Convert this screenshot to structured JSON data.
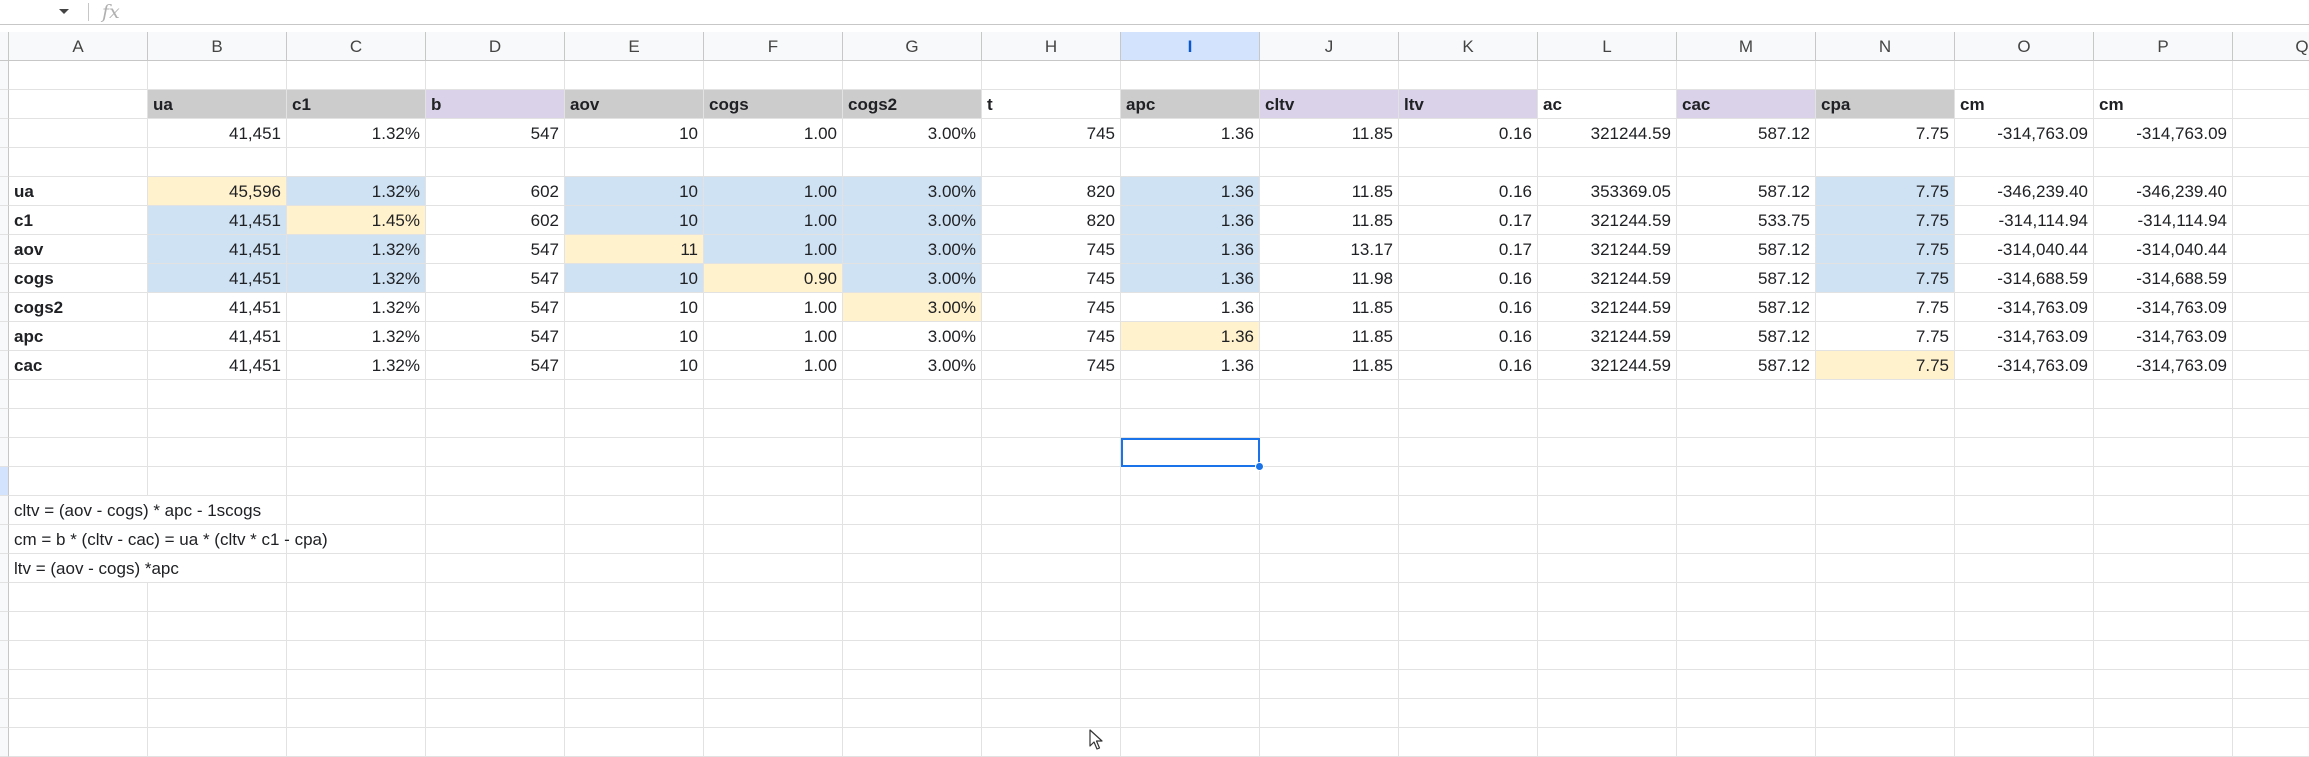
{
  "formula_bar": {
    "fx_label": "fx",
    "formula_value": ""
  },
  "columns": [
    "A",
    "B",
    "C",
    "D",
    "E",
    "F",
    "G",
    "H",
    "I",
    "J",
    "K",
    "L",
    "M",
    "N",
    "O",
    "P",
    "Q"
  ],
  "selected_column": "I",
  "header_row": [
    "",
    "ua",
    "c1",
    "b",
    "aov",
    "cogs",
    "cogs2",
    "t",
    "apc",
    "cltv",
    "ltv",
    "ac",
    "cac",
    "cpa",
    "cm",
    "cm"
  ],
  "base_row": [
    "",
    "41,451",
    "1.32%",
    "547",
    "10",
    "1.00",
    "3.00%",
    "745",
    "1.36",
    "11.85",
    "0.16",
    "321244.59",
    "587.12",
    "7.75",
    "-314,763.09",
    "-314,763.09"
  ],
  "scenario_rows": [
    [
      "ua",
      "45,596",
      "1.32%",
      "602",
      "10",
      "1.00",
      "3.00%",
      "820",
      "1.36",
      "11.85",
      "0.16",
      "353369.05",
      "587.12",
      "7.75",
      "-346,239.40",
      "-346,239.40"
    ],
    [
      "c1",
      "41,451",
      "1.45%",
      "602",
      "10",
      "1.00",
      "3.00%",
      "820",
      "1.36",
      "11.85",
      "0.17",
      "321244.59",
      "533.75",
      "7.75",
      "-314,114.94",
      "-314,114.94"
    ],
    [
      "aov",
      "41,451",
      "1.32%",
      "547",
      "11",
      "1.00",
      "3.00%",
      "745",
      "1.36",
      "13.17",
      "0.17",
      "321244.59",
      "587.12",
      "7.75",
      "-314,040.44",
      "-314,040.44"
    ],
    [
      "cogs",
      "41,451",
      "1.32%",
      "547",
      "10",
      "0.90",
      "3.00%",
      "745",
      "1.36",
      "11.98",
      "0.16",
      "321244.59",
      "587.12",
      "7.75",
      "-314,688.59",
      "-314,688.59"
    ],
    [
      "cogs2",
      "41,451",
      "1.32%",
      "547",
      "10",
      "1.00",
      "3.00%",
      "745",
      "1.36",
      "11.85",
      "0.16",
      "321244.59",
      "587.12",
      "7.75",
      "-314,763.09",
      "-314,763.09"
    ],
    [
      "apc",
      "41,451",
      "1.32%",
      "547",
      "10",
      "1.00",
      "3.00%",
      "745",
      "1.36",
      "11.85",
      "0.16",
      "321244.59",
      "587.12",
      "7.75",
      "-314,763.09",
      "-314,763.09"
    ],
    [
      "cac",
      "41,451",
      "1.32%",
      "547",
      "10",
      "1.00",
      "3.00%",
      "745",
      "1.36",
      "11.85",
      "0.16",
      "321244.59",
      "587.12",
      "7.75",
      "-314,763.09",
      "-314,763.09"
    ]
  ],
  "notes": [
    "cltv = (aov - cogs) * apc - 1scogs",
    "cm = b * (cltv - cac) = ua * (cltv * c1 - cpa)",
    "ltv = (aov - cogs) *apc"
  ],
  "colors": {
    "header_gray": "#cccccc",
    "header_purple": "#d9d2e9",
    "input_blue": "#cfe2f3",
    "changed_yellow": "#fff2cc",
    "selection": "#1a73e8"
  }
}
